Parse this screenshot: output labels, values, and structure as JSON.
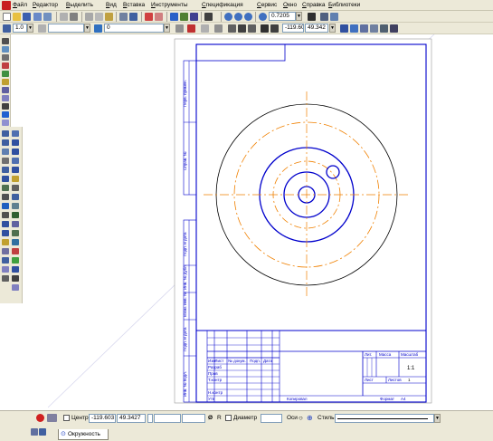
{
  "menu": {
    "items": [
      "Файл",
      "Редактор",
      "Выделить",
      "Вид",
      "Вставка",
      "Инструменты",
      "Спецификация",
      "Сервис",
      "Окно",
      "Справка",
      "Библиотеки"
    ]
  },
  "toolbar": {
    "zoom_value": "0.7205",
    "scale_value": "1.0",
    "layer_value": "0",
    "cursor_x": "-119.60",
    "cursor_y": "49.342"
  },
  "drawing": {
    "title_block": {
      "razrab": "Разраб",
      "prov": "Пров",
      "t_kontr": "Т.контр",
      "n_kontr": "Н.контр",
      "utv": "Утв",
      "izm": "Изм",
      "list": "Лист",
      "n_dokum": "№ докум.",
      "podp": "Подп.",
      "data": "Дата",
      "lit": "Лит.",
      "massa": "Масса",
      "masshtab": "Масштаб",
      "scale_value": "1:1",
      "list2": "Лист",
      "listov": "Листов",
      "listov_value": "1",
      "kopiroval": "Копировал",
      "format": "Формат",
      "format_value": "A4"
    },
    "side_stamps": [
      "Перв. примен.",
      "Справ. №",
      "Подп. и дата",
      "Инв. № дубл.",
      "Взам. инв. №",
      "Подп. и дата",
      "Инв. № подл."
    ]
  },
  "properties": {
    "center_label": "Центр",
    "center_x": "-119.603",
    "center_y": "49.3427",
    "radius_label": "R",
    "diameter_label": "Диаметр",
    "axes_label": "Оси",
    "style_label": "Стиль",
    "tab_label": "Окружность"
  },
  "colors": {
    "frame": "#0000cc",
    "axis": "#f08000",
    "contour": "#000000",
    "thick": "#0000cc"
  }
}
